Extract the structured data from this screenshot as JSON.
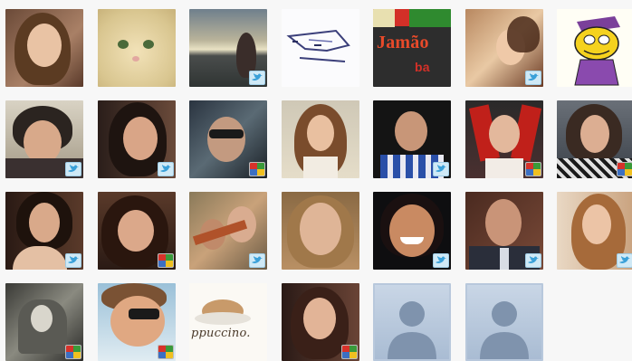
{
  "gallery": {
    "tiles": [
      {
        "name": "avatar-1",
        "badge": ""
      },
      {
        "name": "avatar-2",
        "badge": ""
      },
      {
        "name": "avatar-3",
        "badge": "twitter-icon"
      },
      {
        "name": "avatar-4",
        "badge": ""
      },
      {
        "name": "avatar-5",
        "badge": "",
        "text_top": "Jamão",
        "text_bottom": "ba"
      },
      {
        "name": "avatar-6",
        "badge": "twitter-icon"
      },
      {
        "name": "avatar-7",
        "badge": ""
      },
      {
        "name": "avatar-8",
        "badge": "twitter-icon"
      },
      {
        "name": "avatar-9",
        "badge": "twitter-icon"
      },
      {
        "name": "avatar-10",
        "badge": "multi-service-icon"
      },
      {
        "name": "avatar-11",
        "badge": ""
      },
      {
        "name": "avatar-12",
        "badge": "twitter-icon"
      },
      {
        "name": "avatar-13",
        "badge": "multi-service-icon"
      },
      {
        "name": "avatar-14",
        "badge": "multi-service-icon"
      },
      {
        "name": "avatar-15",
        "badge": "twitter-icon"
      },
      {
        "name": "avatar-16",
        "badge": "multi-service-icon"
      },
      {
        "name": "avatar-17",
        "badge": "twitter-icon"
      },
      {
        "name": "avatar-18",
        "badge": ""
      },
      {
        "name": "avatar-19",
        "badge": "twitter-icon"
      },
      {
        "name": "avatar-20",
        "badge": "twitter-icon"
      },
      {
        "name": "avatar-21",
        "badge": "twitter-icon"
      },
      {
        "name": "avatar-22",
        "badge": "multi-service-icon"
      },
      {
        "name": "avatar-23",
        "badge": "multi-service-icon"
      },
      {
        "name": "avatar-24",
        "badge": "",
        "text_bottom": "ppuccino."
      },
      {
        "name": "avatar-25",
        "badge": "multi-service-icon"
      },
      {
        "name": "avatar-26",
        "badge": "",
        "placeholder": true
      },
      {
        "name": "avatar-27",
        "badge": "",
        "placeholder": true
      }
    ]
  },
  "colors": {
    "twitter_blue": "#3aa0d8",
    "badge_red": "#d7322a",
    "badge_green": "#3a9a3a",
    "badge_blue": "#3c6fc2",
    "badge_yellow": "#f0c020"
  }
}
